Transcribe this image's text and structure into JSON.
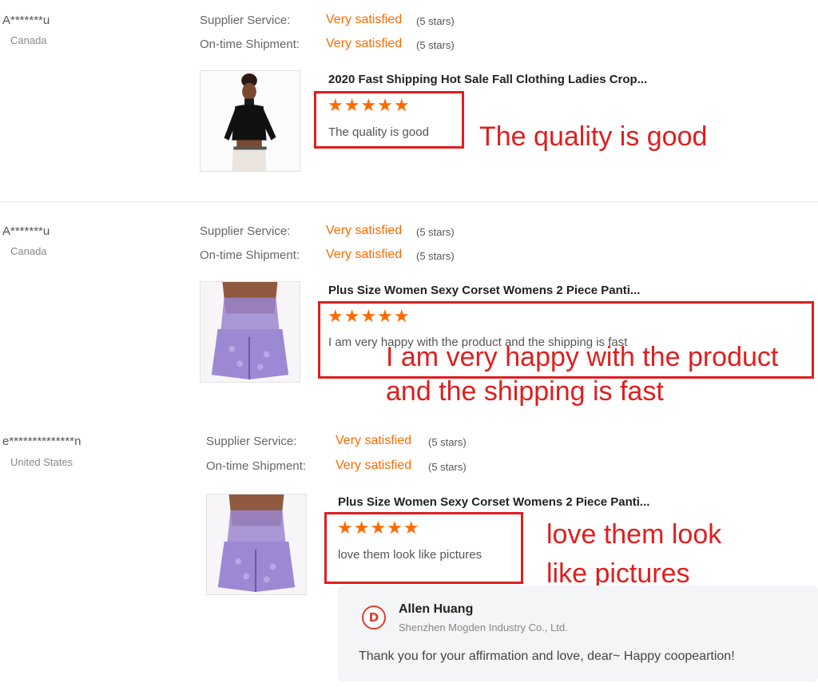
{
  "reviews": [
    {
      "reviewer": "A*******u",
      "country": "Canada",
      "supplier_service_label": "Supplier Service:",
      "supplier_service_value": "Very satisfied",
      "supplier_service_stars": "(5 stars)",
      "shipment_label": "On-time Shipment:",
      "shipment_value": "Very satisfied",
      "shipment_stars": "(5 stars)",
      "product_title": "2020 Fast Shipping Hot Sale Fall Clothing Ladies Crop...",
      "rating": 5,
      "star_glyphs": "★★★★★",
      "feedback": "The quality is good",
      "annotation": [
        "The quality is good"
      ]
    },
    {
      "reviewer": "A*******u",
      "country": "Canada",
      "supplier_service_label": "Supplier Service:",
      "supplier_service_value": "Very satisfied",
      "supplier_service_stars": "(5 stars)",
      "shipment_label": "On-time Shipment:",
      "shipment_value": "Very satisfied",
      "shipment_stars": "(5 stars)",
      "product_title": "Plus Size Women Sexy Corset Womens 2 Piece Panti...",
      "rating": 5,
      "star_glyphs": "★★★★★",
      "feedback": "I am very happy with the product and the shipping is fast",
      "annotation": [
        "I am very happy with the product",
        "and the shipping is fast"
      ]
    },
    {
      "reviewer": "e**************n",
      "country": "United States",
      "supplier_service_label": "Supplier Service:",
      "supplier_service_value": "Very satisfied",
      "supplier_service_stars": "(5 stars)",
      "shipment_label": "On-time Shipment:",
      "shipment_value": "Very satisfied",
      "shipment_stars": "(5 stars)",
      "product_title": "Plus Size Women Sexy Corset Womens 2 Piece Panti...",
      "rating": 5,
      "star_glyphs": "★★★★★",
      "feedback": "love them look like pictures",
      "annotation": [
        "love them look",
        "like pictures"
      ]
    }
  ],
  "reply": {
    "logo_letter": "D",
    "name": "Allen Huang",
    "company": "Shenzhen Mogden Industry Co., Ltd.",
    "message": "Thank you for your affirmation and love, dear~ Happy coopeartion!"
  },
  "colors": {
    "accent": "#ff6a00",
    "annotation": "#e01e1e",
    "logo": "#e23b2e"
  }
}
